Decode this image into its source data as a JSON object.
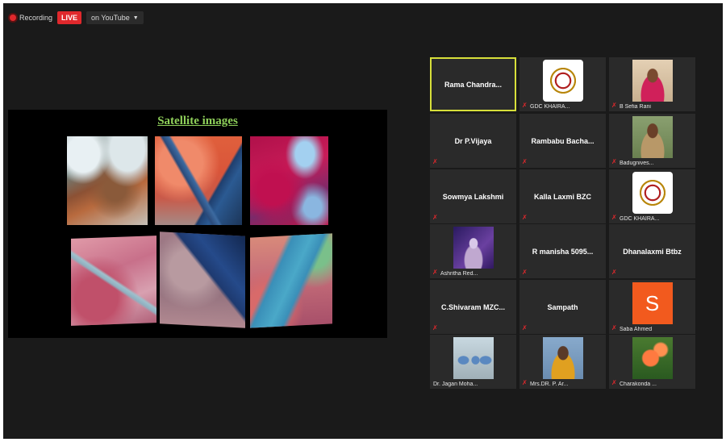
{
  "topbar": {
    "recording_label": "Recording",
    "live_label": "LIVE",
    "youtube_label": "on YouTube"
  },
  "slide": {
    "title": "Satellite images"
  },
  "participants": {
    "p1": {
      "name": "Rama Chandra..."
    },
    "p2": {
      "caption": "GDC KHAIRA..."
    },
    "p3": {
      "caption": "B Sefia Rani"
    },
    "p4": {
      "name": "Dr P.Vijaya"
    },
    "p5": {
      "name": "Rambabu Bacha..."
    },
    "p6": {
      "caption": "Badugnives..."
    },
    "p7": {
      "name": "Sowmya Lakshmi"
    },
    "p8": {
      "name": "Kalla Laxmi BZC"
    },
    "p9": {
      "caption": "GDC KHAIRA..."
    },
    "p10": {
      "caption": "Ashritha Red..."
    },
    "p11": {
      "name": "R manisha 5095..."
    },
    "p12": {
      "name": "Dhanalaxmi Btbz"
    },
    "p13": {
      "name": "C.Shivaram MZC..."
    },
    "p14": {
      "name": "Sampath"
    },
    "p15": {
      "avatar_letter": "S",
      "caption": "Saba Ahmed"
    },
    "p16": {
      "caption": "Dr. Jagan Moha..."
    },
    "p17": {
      "caption": "Mrs.DR. P. Ar..."
    },
    "p18": {
      "caption": "Charakonda ..."
    }
  },
  "colors": {
    "active_speaker_border": "#d7df3a",
    "muted_mic": "#e0282c",
    "live_badge": "#e0282c",
    "slide_title": "#8fd05a"
  }
}
